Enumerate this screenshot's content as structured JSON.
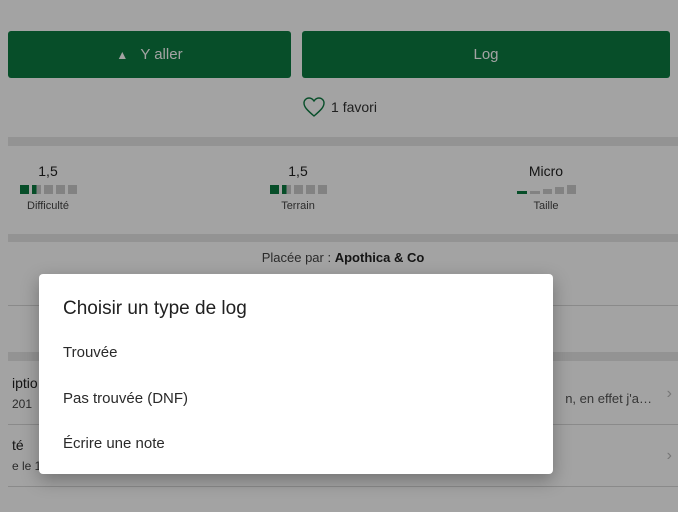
{
  "buttons": {
    "go_label": "Y aller",
    "log_label": "Log"
  },
  "favori": {
    "text": "1 favori"
  },
  "stats": {
    "difficulty": {
      "value": "1,5",
      "label": "Difficulté",
      "level": 1.5,
      "max": 5
    },
    "terrain": {
      "value": "1,5",
      "label": "Terrain",
      "level": 1.5,
      "max": 5
    },
    "size": {
      "value": "Micro",
      "label": "Taille"
    }
  },
  "placed": {
    "prefix": "Placée par : ",
    "owner": "Apothica & Co"
  },
  "rows": [
    {
      "title": "iptio",
      "sub": "201",
      "right": "n, en effet j'a…"
    },
    {
      "title": "té",
      "sub": "e le 1",
      "right": ""
    }
  ],
  "dialog": {
    "title": "Choisir un type de log",
    "options": [
      "Trouvée",
      "Pas trouvée (DNF)",
      "Écrire une note"
    ]
  },
  "colors": {
    "accent": "#0b7a41"
  },
  "icons": {
    "navigate": "navigation-arrow-icon",
    "favorite": "heart-outline-icon",
    "chevron": "chevron-right-icon"
  }
}
